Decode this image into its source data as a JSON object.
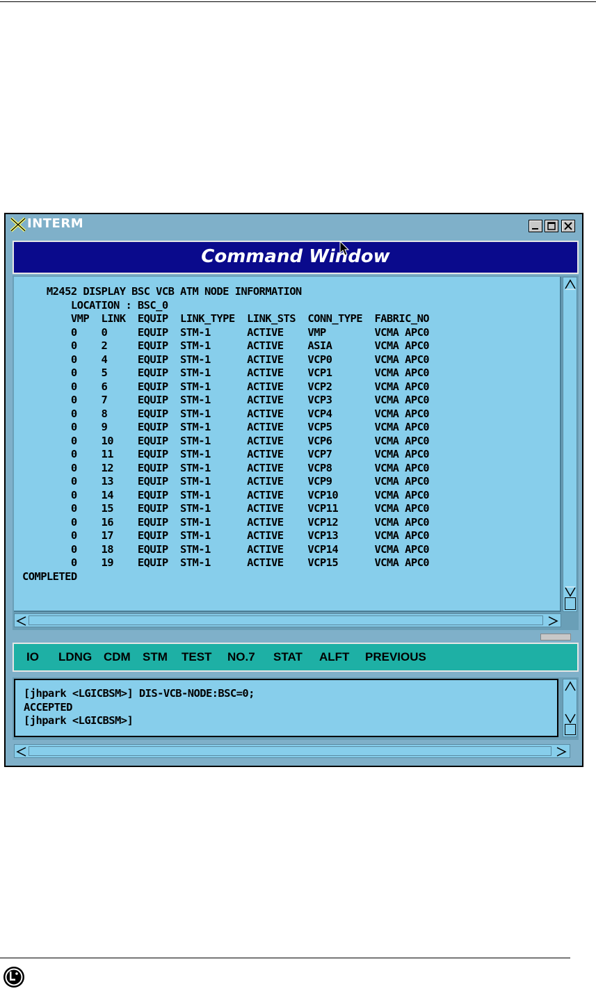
{
  "window": {
    "title": "INTERM"
  },
  "command_header": {
    "title": "Command Window"
  },
  "output": {
    "text": "    M2452 DISPLAY BSC VCB ATM NODE INFORMATION\n        LOCATION : BSC_0\n        VMP  LINK  EQUIP  LINK_TYPE  LINK_STS  CONN_TYPE  FABRIC_NO\n        0    0     EQUIP  STM-1      ACTIVE    VMP        VCMA APC0\n        0    2     EQUIP  STM-1      ACTIVE    ASIA       VCMA APC0\n        0    4     EQUIP  STM-1      ACTIVE    VCP0       VCMA APC0\n        0    5     EQUIP  STM-1      ACTIVE    VCP1       VCMA APC0\n        0    6     EQUIP  STM-1      ACTIVE    VCP2       VCMA APC0\n        0    7     EQUIP  STM-1      ACTIVE    VCP3       VCMA APC0\n        0    8     EQUIP  STM-1      ACTIVE    VCP4       VCMA APC0\n        0    9     EQUIP  STM-1      ACTIVE    VCP5       VCMA APC0\n        0    10    EQUIP  STM-1      ACTIVE    VCP6       VCMA APC0\n        0    11    EQUIP  STM-1      ACTIVE    VCP7       VCMA APC0\n        0    12    EQUIP  STM-1      ACTIVE    VCP8       VCMA APC0\n        0    13    EQUIP  STM-1      ACTIVE    VCP9       VCMA APC0\n        0    14    EQUIP  STM-1      ACTIVE    VCP10      VCMA APC0\n        0    15    EQUIP  STM-1      ACTIVE    VCP11      VCMA APC0\n        0    16    EQUIP  STM-1      ACTIVE    VCP12      VCMA APC0\n        0    17    EQUIP  STM-1      ACTIVE    VCP13      VCMA APC0\n        0    18    EQUIP  STM-1      ACTIVE    VCP14      VCMA APC0\n        0    19    EQUIP  STM-1      ACTIVE    VCP15      VCMA APC0\nCOMPLETED"
  },
  "menu": {
    "items": [
      {
        "label": "IO"
      },
      {
        "label": "LDNG"
      },
      {
        "label": "CDM"
      },
      {
        "label": "STM"
      },
      {
        "label": "TEST"
      },
      {
        "label": "NO.7"
      },
      {
        "label": "STAT"
      },
      {
        "label": "ALFT"
      },
      {
        "label": "PREVIOUS"
      }
    ]
  },
  "input": {
    "text": "[jhpark <LGICBSM>] DIS-VCB-NODE:BSC=0;\nACCEPTED\n[jhpark <LGICBSM>]"
  },
  "colors": {
    "window_bg": "#7fb0c9",
    "header_bg": "#0a0a8c",
    "text_area_bg": "#87ceeb",
    "menu_bg": "#1eb0a5"
  }
}
